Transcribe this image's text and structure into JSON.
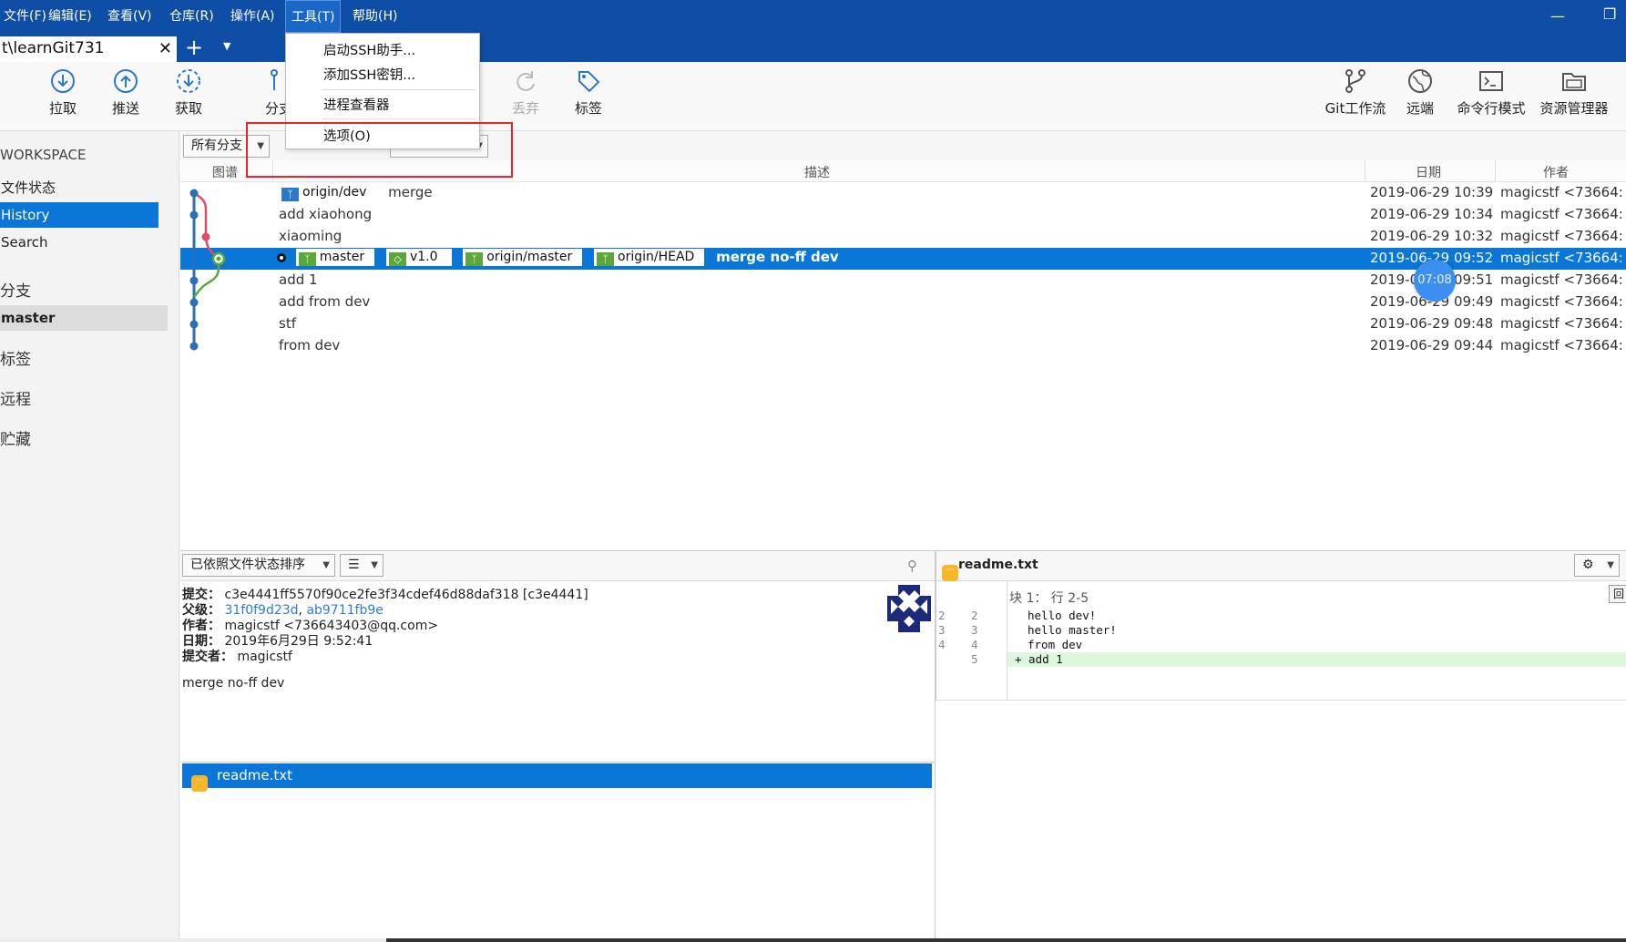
{
  "menu": [
    "文件(F)",
    "编辑(E)",
    "查看(V)",
    "仓库(R)",
    "操作(A)",
    "工具(T)",
    "帮助(H)"
  ],
  "tab": {
    "label": "t\\learnGit731"
  },
  "toolbar": {
    "pull": "拉取",
    "push": "推送",
    "fetch": "获取",
    "branch": "分支",
    "discard": "丢弃",
    "tag": "标签",
    "git_flow": "Git工作流",
    "remote": "远端",
    "terminal": "命令行模式",
    "explorer": "资源管理器"
  },
  "tools_menu": [
    "启动SSH助手...",
    "添加SSH密钥...",
    "进程查看器",
    "选项(O)"
  ],
  "sidebar": {
    "workspace": "WORKSPACE",
    "file_status": "文件状态",
    "history": "History",
    "search": "Search",
    "branches": "分支",
    "branch_master": "master",
    "tags": "标签",
    "remotes": "远程",
    "stashes": "贮藏"
  },
  "filter": {
    "branches": "所有分支"
  },
  "columns": {
    "graph": "图谱",
    "description": "描述",
    "date": "日期",
    "author": "作者"
  },
  "commits": [
    {
      "refs": [
        "origin/dev"
      ],
      "message": "merge",
      "date": "2019-06-29 10:39",
      "author": "magicstf <73664:"
    },
    {
      "message": "add xiaohong",
      "date": "2019-06-29 10:34",
      "author": "magicstf <73664:"
    },
    {
      "message": "xiaoming",
      "date": "2019-06-29 10:32",
      "author": "magicstf <73664:"
    },
    {
      "refs": [
        "master",
        "v1.0",
        "origin/master",
        "origin/HEAD"
      ],
      "message": "merge no-ff dev",
      "date": "2019-06-29 09:52",
      "author": "magicstf <73664:"
    },
    {
      "message": "add 1",
      "date": "2019-06-29 09:51",
      "author": "magicstf <73664:"
    },
    {
      "message": "add from dev",
      "date": "2019-06-29 09:49",
      "author": "magicstf <73664:"
    },
    {
      "message": "stf",
      "date": "2019-06-29 09:48",
      "author": "magicstf <73664:"
    },
    {
      "message": "from dev",
      "date": "2019-06-29 09:44",
      "author": "magicstf <73664:"
    }
  ],
  "overlay": {
    "timer": "07:08"
  },
  "files": {
    "sort_label": "已依照文件状态排序",
    "items": [
      "readme.txt"
    ]
  },
  "details": {
    "commit_label": "提交：",
    "commit": "c3e4441ff5570f90ce2fe3f34cdef46d88daf318 [c3e4441]",
    "parents_label": "父级：",
    "parent_1": "31f0f9d23d",
    "parent_2": "ab9711fb9e",
    "author_label": "作者：",
    "author": "magicstf <736643403@qq.com>",
    "date_label": "日期：",
    "date": "2019年6月29日 9:52:41",
    "committer_label": "提交者：",
    "committer": "magicstf",
    "message": "merge no-ff dev"
  },
  "diff": {
    "filename": "readme.txt",
    "hunk": "块 1： 行 2-5",
    "hunk_button": "回",
    "lines": [
      {
        "old": "2",
        "new": "2",
        "text": "hello dev!"
      },
      {
        "old": "3",
        "new": "3",
        "text": "hello master!"
      },
      {
        "old": "4",
        "new": "4",
        "text": "from dev"
      },
      {
        "old": "",
        "new": "5",
        "text": "+ add 1"
      }
    ]
  }
}
